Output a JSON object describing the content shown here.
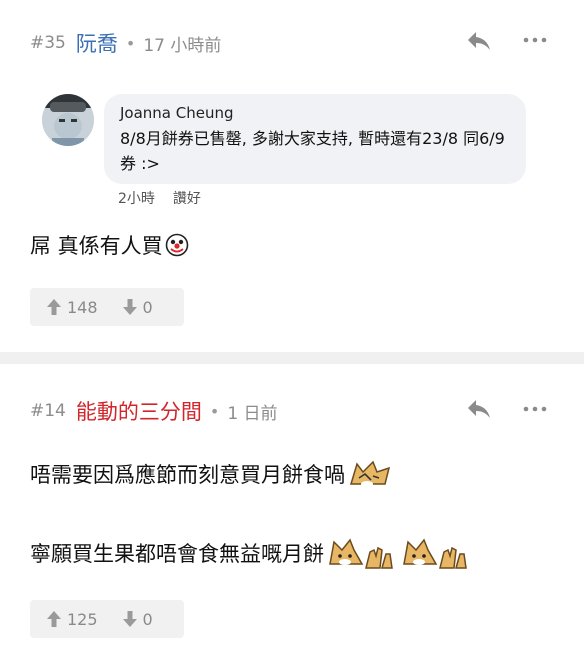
{
  "posts": [
    {
      "number": "#35",
      "author": "阮喬",
      "author_color": "#3b6fb6",
      "time": "17 小時前",
      "quote": {
        "name": "Joanna Cheung",
        "text": "8/8月餅券已售罄, 多謝大家支持, 暫時還有23/8 同6/9券 :>",
        "time": "2小時",
        "like": "讚好"
      },
      "lines": [
        "屌 真係有人買"
      ],
      "upvotes": "148",
      "downvotes": "0"
    },
    {
      "number": "#14",
      "author": "能動的三分間",
      "author_color": "#d2262c",
      "time": "1 日前",
      "lines": [
        "唔需要因爲應節而刻意買月餅食喎",
        "寧願買生果都唔會食無益嘅月餅"
      ],
      "upvotes": "125",
      "downvotes": "0"
    }
  ],
  "icons": {
    "reply": "reply-arrow-icon",
    "more": "more-dots-icon",
    "upvote": "arrow-up-icon",
    "downvote": "arrow-down-icon",
    "emoji_face": "clown-face-emoji-icon",
    "emoji_dog": "shiba-dog-emoji-icon"
  }
}
